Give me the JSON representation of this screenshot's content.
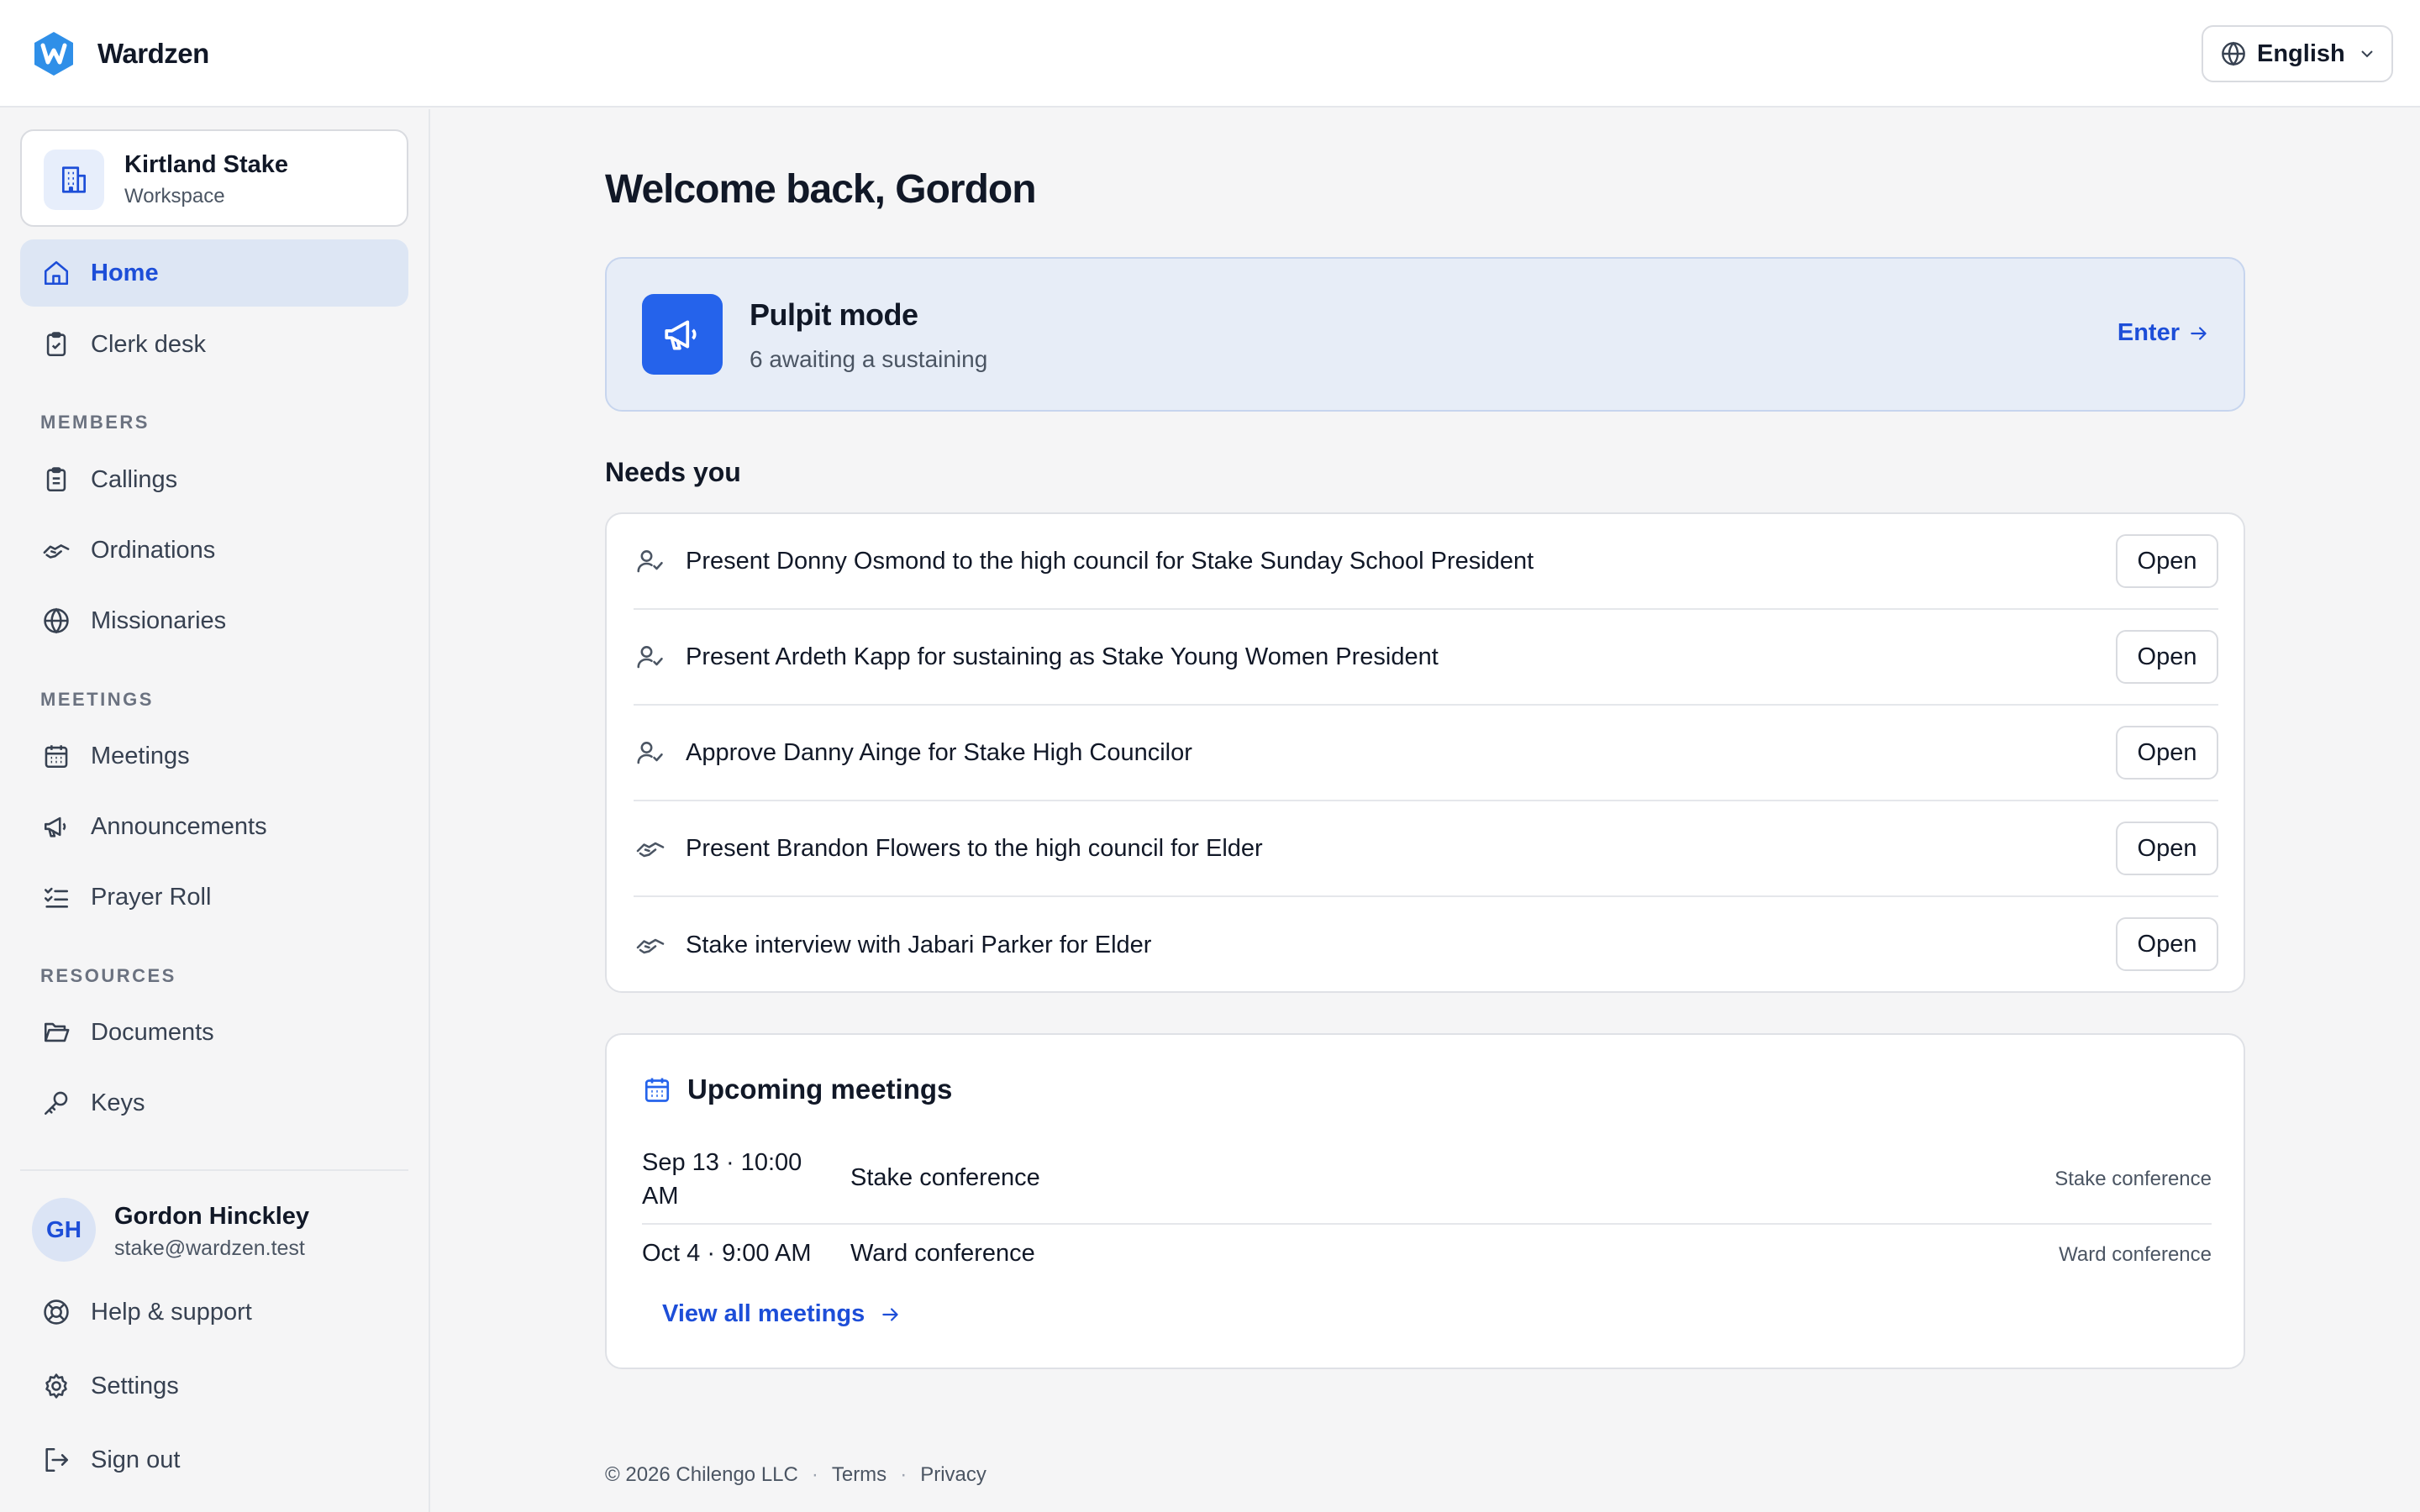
{
  "app": {
    "name": "Wardzen"
  },
  "header": {
    "language": "English"
  },
  "workspace": {
    "name": "Kirtland Stake",
    "type": "Workspace"
  },
  "nav": {
    "top": [
      {
        "label": "Home",
        "icon": "home-icon",
        "active": true
      },
      {
        "label": "Clerk desk",
        "icon": "clipboard-check-icon"
      }
    ],
    "sections": [
      {
        "title": "MEMBERS",
        "items": [
          {
            "label": "Callings",
            "icon": "clipboard-list-icon"
          },
          {
            "label": "Ordinations",
            "icon": "handshake-icon"
          },
          {
            "label": "Missionaries",
            "icon": "globe-icon"
          }
        ]
      },
      {
        "title": "MEETINGS",
        "items": [
          {
            "label": "Meetings",
            "icon": "calendar-icon"
          },
          {
            "label": "Announcements",
            "icon": "megaphone-icon"
          },
          {
            "label": "Prayer Roll",
            "icon": "list-checks-icon"
          }
        ]
      },
      {
        "title": "RESOURCES",
        "items": [
          {
            "label": "Documents",
            "icon": "folder-open-icon"
          },
          {
            "label": "Keys",
            "icon": "key-icon"
          }
        ]
      }
    ],
    "bottom": [
      {
        "label": "Help & support",
        "icon": "lifebuoy-icon"
      },
      {
        "label": "Settings",
        "icon": "gear-icon"
      },
      {
        "label": "Sign out",
        "icon": "sign-out-icon"
      }
    ]
  },
  "user": {
    "initials": "GH",
    "name": "Gordon Hinckley",
    "email": "stake@wardzen.test"
  },
  "main": {
    "welcome": "Welcome back, Gordon",
    "pulpit": {
      "title": "Pulpit mode",
      "subtitle": "6 awaiting a sustaining",
      "action": "Enter"
    },
    "needs_title": "Needs you",
    "tasks": [
      {
        "text": "Present Donny Osmond to the high council for Stake Sunday School President",
        "icon": "user-check-icon",
        "action": "Open"
      },
      {
        "text": "Present Ardeth Kapp for sustaining as Stake Young Women President",
        "icon": "user-check-icon",
        "action": "Open"
      },
      {
        "text": "Approve Danny Ainge for Stake High Councilor",
        "icon": "user-check-icon",
        "action": "Open"
      },
      {
        "text": "Present Brandon Flowers to the high council for Elder",
        "icon": "handshake-icon",
        "action": "Open"
      },
      {
        "text": "Stake interview with Jabari Parker for Elder",
        "icon": "handshake-icon",
        "action": "Open"
      }
    ],
    "meetings": {
      "title": "Upcoming meetings",
      "rows": [
        {
          "date": "Sep 13 · 10:00 AM",
          "name": "Stake conference",
          "type": "Stake conference"
        },
        {
          "date": "Oct 4 · 9:00 AM",
          "name": "Ward conference",
          "type": "Ward conference"
        }
      ],
      "view_all": "View all meetings"
    }
  },
  "footer": {
    "copyright": "© 2026 Chilengo LLC",
    "terms": "Terms",
    "privacy": "Privacy"
  },
  "colors": {
    "accent": "#2563eb",
    "accent_text": "#1d4ed8",
    "active_nav_bg": "#dde6f4",
    "pulpit_bg": "#e7edf7"
  }
}
